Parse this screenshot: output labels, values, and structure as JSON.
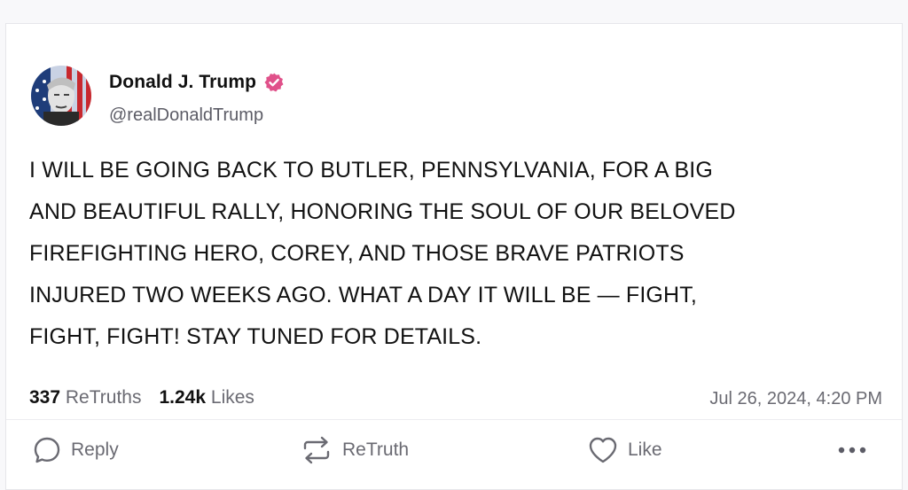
{
  "author": {
    "display_name": "Donald J. Trump",
    "handle": "@realDonaldTrump",
    "verified": true,
    "verified_color": "#e0518a"
  },
  "post": {
    "lines": [
      "I WILL BE GOING BACK TO BUTLER, PENNSYLVANIA, FOR A BIG",
      "AND BEAUTIFUL RALLY, HONORING THE SOUL OF OUR BELOVED",
      "FIREFIGHTING HERO, COREY, AND THOSE BRAVE PATRIOTS",
      "INJURED TWO WEEKS AGO. WHAT A DAY IT WILL BE — FIGHT,",
      "FIGHT, FIGHT! STAY TUNED FOR DETAILS."
    ],
    "timestamp": "Jul 26, 2024, 4:20 PM"
  },
  "stats": {
    "retruths_count": "337",
    "retruths_label": "ReTruths",
    "likes_count": "1.24k",
    "likes_label": "Likes"
  },
  "actions": {
    "reply_label": "Reply",
    "retruth_label": "ReTruth",
    "like_label": "Like",
    "more_icon": "more-horizontal-icon"
  },
  "icons": {
    "reply": "reply-bubble-icon",
    "retruth": "retruth-arrows-icon",
    "like": "heart-icon",
    "verified": "verified-badge-icon"
  }
}
